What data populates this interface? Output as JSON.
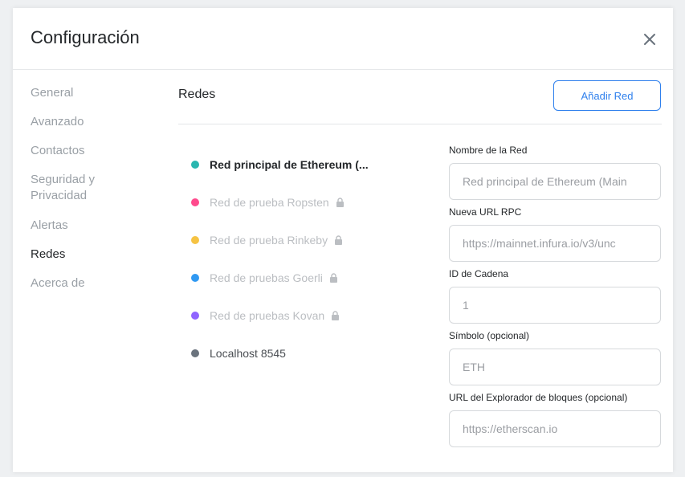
{
  "header": {
    "title": "Configuración"
  },
  "sidebar": {
    "items": [
      {
        "label": "General"
      },
      {
        "label": "Avanzado"
      },
      {
        "label": "Contactos"
      },
      {
        "label": "Seguridad y Privacidad"
      },
      {
        "label": "Alertas"
      },
      {
        "label": "Redes"
      },
      {
        "label": "Acerca de"
      }
    ],
    "active": "Redes"
  },
  "content": {
    "title": "Redes",
    "add_button": "Añadir Red"
  },
  "networks": [
    {
      "name": "Red principal de Ethereum (...",
      "color": "#29b6af",
      "locked": false,
      "active": true
    },
    {
      "name": "Red de prueba Ropsten",
      "color": "#ff4a8d",
      "locked": true
    },
    {
      "name": "Red de prueba Rinkeby",
      "color": "#f6c343",
      "locked": true
    },
    {
      "name": "Red de pruebas Goerli",
      "color": "#3099f2",
      "locked": true
    },
    {
      "name": "Red de pruebas Kovan",
      "color": "#9064ff",
      "locked": true
    },
    {
      "name": "Localhost 8545",
      "color": "#6a737d",
      "locked": false
    }
  ],
  "form": {
    "network_name": {
      "label": "Nombre de la Red",
      "value": "Red principal de Ethereum (Main"
    },
    "rpc_url": {
      "label": "Nueva URL RPC",
      "value": "https://mainnet.infura.io/v3/unc"
    },
    "chain_id": {
      "label": "ID de Cadena",
      "value": "1"
    },
    "symbol": {
      "label": "Símbolo (opcional)",
      "value": "ETH"
    },
    "explorer": {
      "label": "URL del Explorador de bloques (opcional)",
      "value": "https://etherscan.io"
    }
  }
}
